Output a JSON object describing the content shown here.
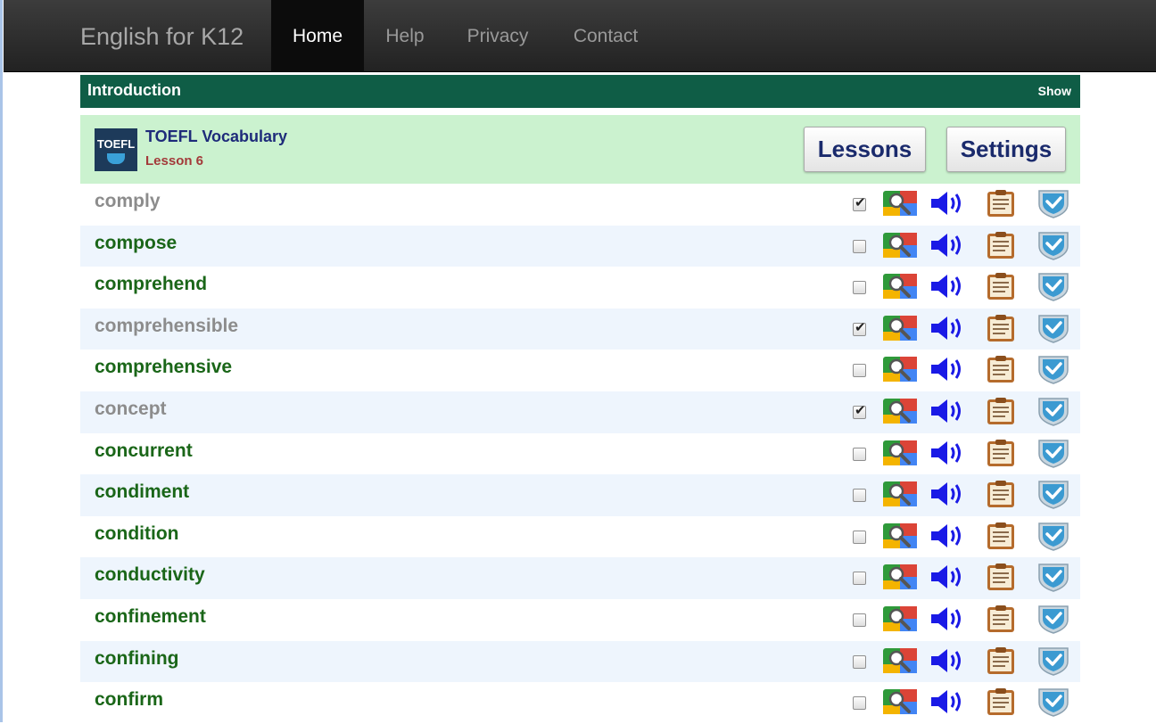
{
  "nav": {
    "brand": "English for K12",
    "items": [
      {
        "label": "Home",
        "active": true
      },
      {
        "label": "Help",
        "active": false
      },
      {
        "label": "Privacy",
        "active": false
      },
      {
        "label": "Contact",
        "active": false
      }
    ]
  },
  "intro": {
    "title": "Introduction",
    "toggle": "Show"
  },
  "lesson": {
    "logo_text": "TOEFL",
    "title": "TOEFL Vocabulary",
    "lesson_label": "Lesson 6",
    "lessons_button": "Lessons",
    "settings_button": "Settings"
  },
  "row_icons": [
    "search-icon",
    "speaker-icon",
    "clipboard-icon",
    "shield-check-icon"
  ],
  "words": [
    {
      "word": "comply",
      "checked": true
    },
    {
      "word": "compose",
      "checked": false
    },
    {
      "word": "comprehend",
      "checked": false
    },
    {
      "word": "comprehensible",
      "checked": true
    },
    {
      "word": "comprehensive",
      "checked": false
    },
    {
      "word": "concept",
      "checked": true
    },
    {
      "word": "concurrent",
      "checked": false
    },
    {
      "word": "condiment",
      "checked": false
    },
    {
      "word": "condition",
      "checked": false
    },
    {
      "word": "conductivity",
      "checked": false
    },
    {
      "word": "confinement",
      "checked": false
    },
    {
      "word": "confining",
      "checked": false
    },
    {
      "word": "confirm",
      "checked": false
    }
  ],
  "colors": {
    "intro_bar": "#0f5d46",
    "lesson_bg": "#cbf2cf",
    "word_active": "#1a6618",
    "word_done": "#8c8c8c",
    "row_alt": "#eef5fd",
    "speaker": "#1a1ae6"
  }
}
